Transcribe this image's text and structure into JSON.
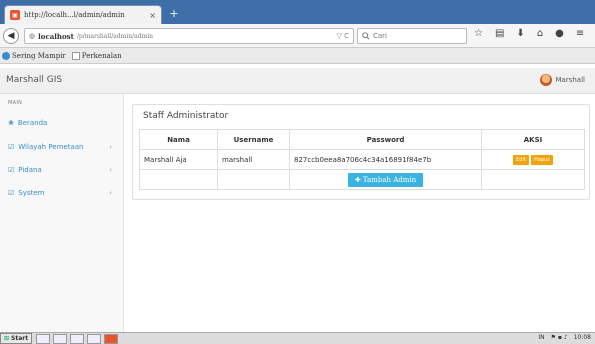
{
  "browser": {
    "tab_title": "http://localh...l/admin/admin",
    "tab_close": "×",
    "new_tab": "+",
    "url_host": "localhost",
    "url_path": "/p/marshall/admin/admin",
    "url_icons": "▽ C",
    "search_placeholder": "Cari",
    "toolbar_icons": [
      "star-icon",
      "clipboard-icon",
      "download-icon",
      "home-icon",
      "chat-icon",
      "menu-icon"
    ]
  },
  "bookmarks": [
    "Sering Mampir",
    "Perkenalan"
  ],
  "app": {
    "brand": "Marshall GIS",
    "user_name": "Marshall"
  },
  "sidebar": {
    "section": "MAIN",
    "items": [
      {
        "label": "Beranda",
        "icon": "dashboard-icon",
        "has_children": false
      },
      {
        "label": "Wilayah Pemetaan",
        "icon": "edit-icon",
        "has_children": true
      },
      {
        "label": "Pidana",
        "icon": "edit-icon",
        "has_children": true
      },
      {
        "label": "System",
        "icon": "edit-icon",
        "has_children": true
      }
    ]
  },
  "main": {
    "panel_title": "Staff Administrator",
    "columns": [
      "Nama",
      "Username",
      "Password",
      "AKSI"
    ],
    "rows": [
      {
        "nama": "Marshall Aja",
        "username": "marshall",
        "password": "827ccb0eea8a706c4c34a16891f84e7b",
        "edit": "Edit",
        "hapus": "Hapus"
      }
    ],
    "add_button": "Tambah Admin"
  },
  "taskbar": {
    "start": "Start",
    "lang": "IN",
    "time": "10:08"
  },
  "colors": {
    "accent": "#3a8dcf",
    "warning": "#f0a30a",
    "info": "#3bb3e0"
  }
}
